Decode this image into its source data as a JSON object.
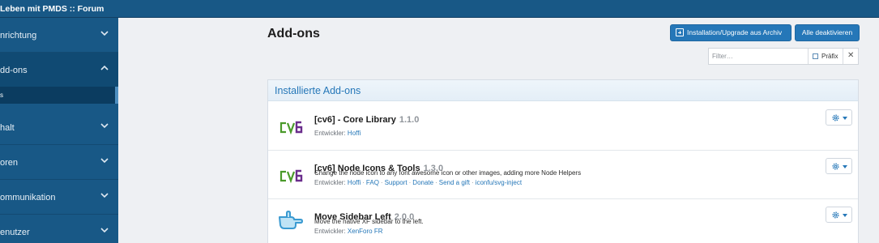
{
  "header": {
    "title": "Leben mit PMDS :: Forum"
  },
  "sidebar": {
    "items": [
      {
        "label": "nrichtung"
      },
      {
        "label": "dd-ons"
      },
      {
        "label": "halt"
      },
      {
        "label": "oren"
      },
      {
        "label": "ommunikation"
      },
      {
        "label": "enutzer"
      }
    ],
    "subitem": {
      "label": "s"
    }
  },
  "page": {
    "title": "Add-ons",
    "archive_button": "Installation/Upgrade aus Archiv",
    "deactivate_button": "Alle deaktivieren"
  },
  "filter": {
    "placeholder": "Filter…",
    "prefix_label": "Präfix",
    "clear": "✕"
  },
  "panel": {
    "title": "Installierte Add-ons"
  },
  "addons": [
    {
      "name": "[cv6] - Core Library",
      "version": "1.1.0",
      "description": "",
      "developer_label": "Entwickler:",
      "links": [
        "Hoffi"
      ],
      "logo": "cv6-logo"
    },
    {
      "name": "[cv6] Node Icons & Tools",
      "version": "1.3.0",
      "description": "Change the node icon to any font awesome icon or other images, adding more Node Helpers",
      "developer_label": "Entwickler:",
      "links": [
        "Hoffi",
        "FAQ",
        "Support",
        "Donate",
        "Send a gift",
        "iconfu/svg-inject"
      ],
      "logo": "cv6-logo"
    },
    {
      "name": "Move Sidebar Left",
      "version": "2.0.0",
      "description": "Move the native XF sidebar to the left.",
      "developer_label": "Entwickler:",
      "links": [
        "XenForo FR"
      ],
      "logo": "hand-pointer-icon"
    }
  ],
  "colors": {
    "brand": "#185886",
    "accent": "#2577b8",
    "logo_green": "#4a9a2a",
    "logo_purple": "#6a2d8c"
  }
}
